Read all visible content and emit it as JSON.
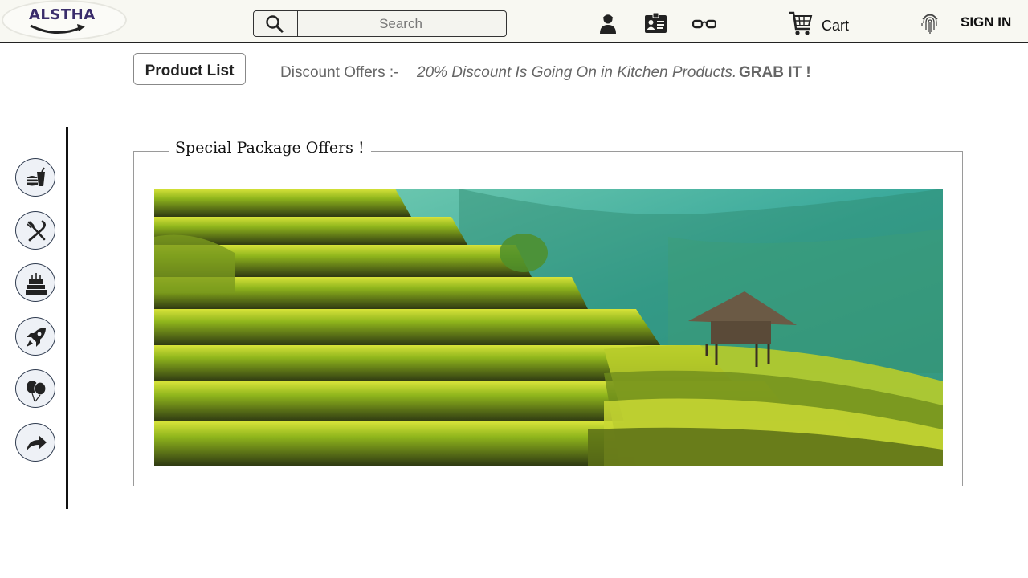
{
  "header": {
    "logo_text": "ALSTHA",
    "search": {
      "placeholder": "Search"
    },
    "cart_label": "Cart",
    "signin_label": "SIGN IN",
    "icons": [
      "search-icon",
      "support-agent-icon",
      "id-card-icon",
      "glasses-icon",
      "shopping-cart-icon",
      "fingerprint-icon"
    ]
  },
  "subbar": {
    "product_list_label": "Product List",
    "offers_label": "Discount Offers :-",
    "offers_text": "20% Discount Is Going On in Kitchen Products.",
    "offers_cta": "GRAB IT !"
  },
  "sidebar": {
    "items": [
      {
        "icon": "fast-food-icon"
      },
      {
        "icon": "fork-knife-icon"
      },
      {
        "icon": "birthday-cake-icon"
      },
      {
        "icon": "rocket-icon"
      },
      {
        "icon": "balloons-icon"
      },
      {
        "icon": "share-arrow-icon"
      }
    ]
  },
  "main": {
    "panel_title": "Special Package Offers !",
    "banner_image": "rice-terraces-with-hut"
  },
  "colors": {
    "header_bg": "#f8f8f2",
    "logo_text": "#3a2d6b",
    "sidebar_border": "#2f3b4f",
    "muted_text": "#666666"
  }
}
